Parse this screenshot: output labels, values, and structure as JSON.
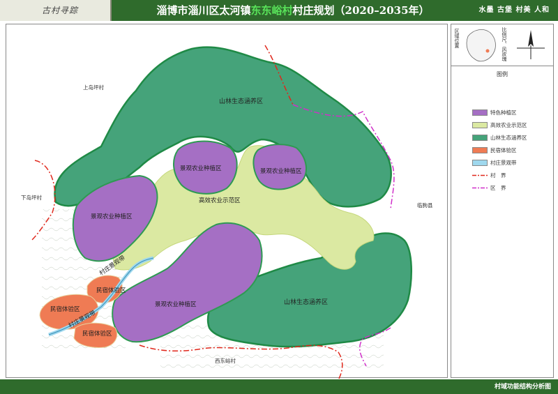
{
  "header": {
    "logo_text": "古村寻踪",
    "title_prefix": "淄博市淄川区太河镇",
    "title_highlight": "东东峪村",
    "title_suffix": "村庄规划（2020–2035年）",
    "slogan": "水墨 古堡 村美 人和"
  },
  "inset": {
    "region_label": "区域位置",
    "scale_label": "比例尺、风玫瑰"
  },
  "legend": {
    "title": "图例",
    "items": [
      {
        "label": "特色种植区",
        "color": "#a56fc4"
      },
      {
        "label": "高效农业示范区",
        "color": "#dbe9a2"
      },
      {
        "label": "山林生态涵养区",
        "color": "#45a37a"
      },
      {
        "label": "民宿体验区",
        "color": "#ef7b54"
      },
      {
        "label": "村庄景观带",
        "color": "#9fd8ee"
      },
      {
        "label": "村　界",
        "color": "#e0271b"
      },
      {
        "label": "区　界",
        "color": "#d02fc9"
      }
    ]
  },
  "map": {
    "zones": {
      "forest_north": "山林生态涵养区",
      "forest_south": "山林生态涵养区",
      "landscape_1": "景观农业种植区",
      "landscape_2": "景观农业种植区",
      "landscape_3": "景观农业种植区",
      "landscape_4": "景观农业种植区",
      "agri_demo": "高效农业示范区",
      "homestay_1": "民宿体验区",
      "homestay_2": "民宿体验区",
      "homestay_3": "民宿体验区",
      "belt_1": "村庄景观带",
      "belt_2": "村庄景观带"
    },
    "neighbors": {
      "north": "上岛坪村",
      "west": "下岛坪村",
      "east": "临朐县",
      "south": "西东峪村"
    }
  },
  "footer": {
    "caption": "村域功能结构分析图"
  }
}
